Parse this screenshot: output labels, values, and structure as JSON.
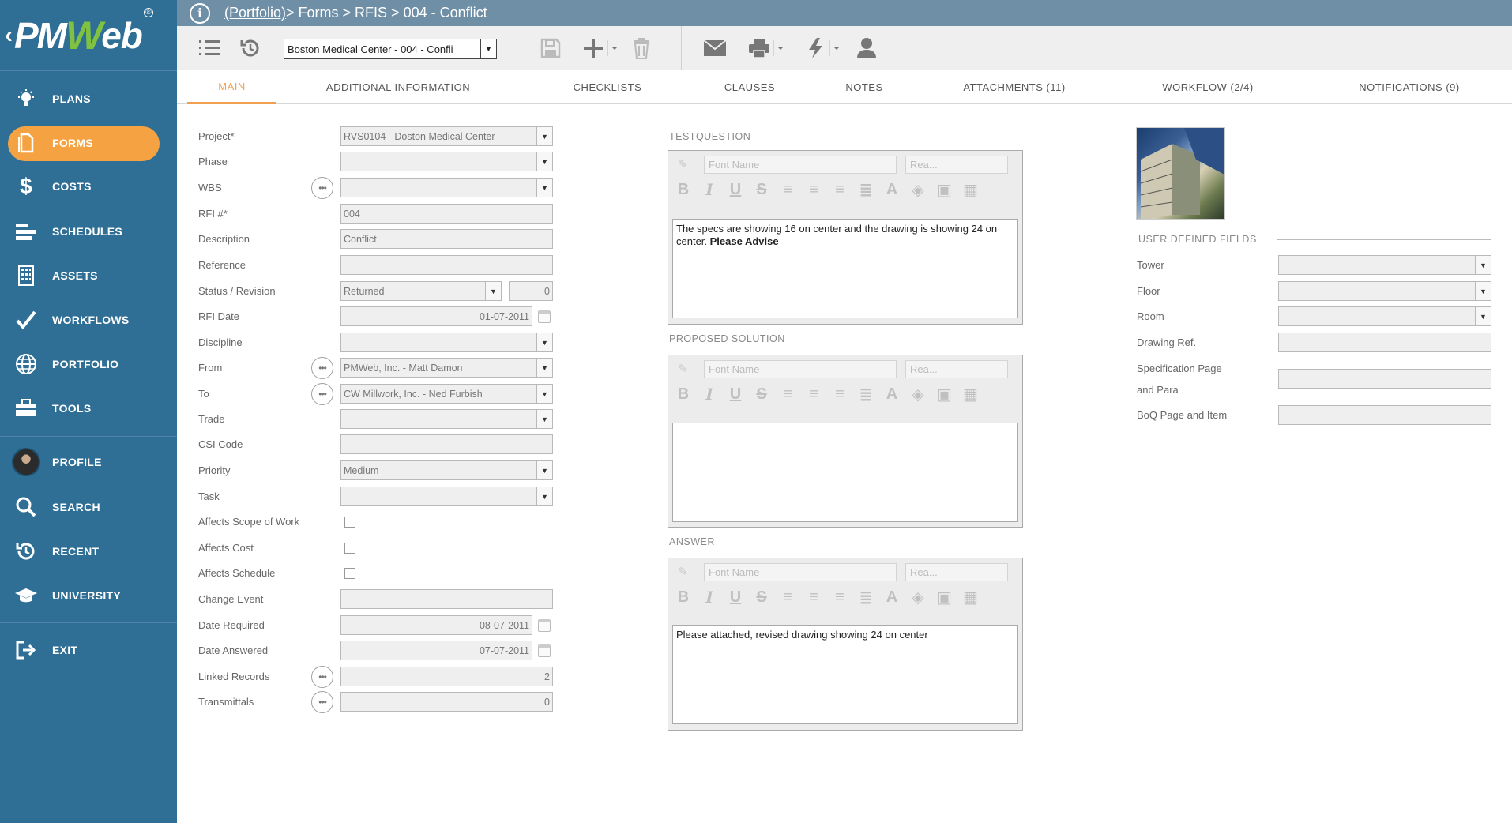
{
  "brand": {
    "logo_pm": "PM",
    "logo_w": "W",
    "logo_eb": "eb"
  },
  "sidebar": {
    "items": [
      {
        "label": "PLANS",
        "icon": "lightbulb-icon"
      },
      {
        "label": "FORMS",
        "icon": "document-icon"
      },
      {
        "label": "COSTS",
        "icon": "dollar-icon"
      },
      {
        "label": "SCHEDULES",
        "icon": "schedule-bars-icon"
      },
      {
        "label": "ASSETS",
        "icon": "building-icon"
      },
      {
        "label": "WORKFLOWS",
        "icon": "check-icon"
      },
      {
        "label": "PORTFOLIO",
        "icon": "globe-icon"
      },
      {
        "label": "TOOLS",
        "icon": "toolbox-icon"
      },
      {
        "label": "PROFILE",
        "icon": "avatar-icon"
      },
      {
        "label": "SEARCH",
        "icon": "search-icon"
      },
      {
        "label": "RECENT",
        "icon": "history-icon"
      },
      {
        "label": "UNIVERSITY",
        "icon": "graduation-cap-icon"
      },
      {
        "label": "EXIT",
        "icon": "exit-icon"
      }
    ],
    "active": "FORMS",
    "active_color": "#f5a243",
    "bg_color": "#2f6e95"
  },
  "header": {
    "portfolio_link": "(Portfolio)",
    "path": " > Forms > RFIS > 004 - Conflict"
  },
  "toolbar": {
    "record_select": "Boston Medical Center - 004 - Confli"
  },
  "tabs": [
    {
      "label": "MAIN",
      "active": true
    },
    {
      "label": "ADDITIONAL INFORMATION"
    },
    {
      "label": "CHECKLISTS"
    },
    {
      "label": "CLAUSES"
    },
    {
      "label": "NOTES"
    },
    {
      "label": "ATTACHMENTS (11)"
    },
    {
      "label": "WORKFLOW (2/4)"
    },
    {
      "label": "NOTIFICATIONS (9)"
    }
  ],
  "form": {
    "project": {
      "label": "Project*",
      "value": "RVS0104 - Doston Medical Center"
    },
    "phase": {
      "label": "Phase",
      "value": ""
    },
    "wbs": {
      "label": "WBS",
      "value": ""
    },
    "rfi_no": {
      "label": "RFI #*",
      "value": "004"
    },
    "description": {
      "label": "Description",
      "value": "Conflict"
    },
    "reference": {
      "label": "Reference",
      "value": ""
    },
    "status": {
      "label": "Status / Revision",
      "value": "Returned",
      "revision": "0"
    },
    "rfi_date": {
      "label": "RFI Date",
      "value": "01-07-2011"
    },
    "discipline": {
      "label": "Discipline",
      "value": ""
    },
    "from": {
      "label": "From",
      "value": "PMWeb, Inc. - Matt Damon"
    },
    "to": {
      "label": "To",
      "value": "CW Millwork, Inc. - Ned Furbish"
    },
    "trade": {
      "label": "Trade",
      "value": ""
    },
    "csi_code": {
      "label": "CSI Code",
      "value": ""
    },
    "priority": {
      "label": "Priority",
      "value": "Medium"
    },
    "task": {
      "label": "Task",
      "value": ""
    },
    "affects_scope": {
      "label": "Affects Scope of Work",
      "checked": false
    },
    "affects_cost": {
      "label": "Affects Cost",
      "checked": false
    },
    "affects_schedule": {
      "label": "Affects Schedule",
      "checked": false
    },
    "change_event": {
      "label": "Change Event",
      "value": ""
    },
    "date_required": {
      "label": "Date Required",
      "value": "08-07-2011"
    },
    "date_answered": {
      "label": "Date Answered",
      "value": "07-07-2011"
    },
    "linked_records": {
      "label": "Linked Records",
      "value": "2"
    },
    "transmittals": {
      "label": "Transmittals",
      "value": "0"
    }
  },
  "editors": {
    "font_placeholder": "Font Name",
    "size_placeholder": "Rea...",
    "question": {
      "title": "TESTQUESTION",
      "text": "The specs are showing 16 on center and the drawing is showing 24 on center. ",
      "text_bold": "Please Advise"
    },
    "solution": {
      "title": "PROPOSED SOLUTION",
      "text": ""
    },
    "answer": {
      "title": "ANSWER",
      "text": "Please attached, revised drawing showing 24 on center"
    }
  },
  "udf": {
    "title": "USER DEFINED FIELDS",
    "tower": "Tower",
    "floor": "Floor",
    "room": "Room",
    "drawing_ref": "Drawing Ref.",
    "spec_page_1": "Specification Page",
    "spec_page_2": "and Para",
    "boq": "BoQ Page and Item"
  }
}
